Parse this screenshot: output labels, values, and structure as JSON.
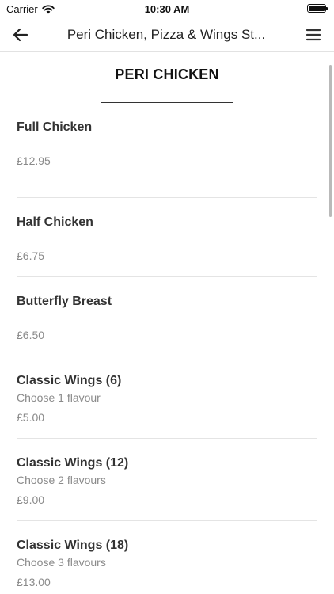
{
  "status_bar": {
    "carrier": "Carrier",
    "time": "10:30 AM",
    "icons": [
      "wifi-icon",
      "battery-icon"
    ]
  },
  "nav": {
    "title": "Peri Chicken, Pizza & Wings St...",
    "icons": [
      "back-arrow-icon",
      "hamburger-menu-icon"
    ]
  },
  "section": {
    "title": "PERI CHICKEN"
  },
  "items": [
    {
      "name": "Full Chicken",
      "price": "£12.95"
    },
    {
      "name": "Half Chicken",
      "price": "£6.75"
    },
    {
      "name": "Butterfly Breast",
      "price": "£6.50"
    },
    {
      "name": "Classic Wings (6)",
      "description": "Choose 1 flavour",
      "price": "£5.00"
    },
    {
      "name": "Classic Wings (12)",
      "description": "Choose 2 flavours",
      "price": "£9.00"
    },
    {
      "name": "Classic Wings (18)",
      "description": "Choose 3 flavours",
      "price": "£13.00"
    }
  ],
  "colors": {
    "text_primary": "#333333",
    "text_secondary": "#8a8a8a",
    "divider": "#e4e4e4"
  }
}
